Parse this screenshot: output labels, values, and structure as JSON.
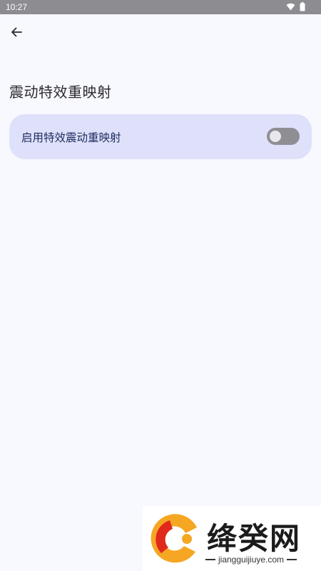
{
  "status_bar": {
    "time": "10:27",
    "icons": [
      "wifi-icon",
      "battery-icon"
    ]
  },
  "header": {
    "back_icon": "arrow-left-icon"
  },
  "page": {
    "title": "震动特效重映射"
  },
  "setting": {
    "label": "启用特效震动重映射",
    "toggle_on": false
  },
  "watermark": {
    "brand": "绛癸网",
    "domain": "jiangguijiuye.com"
  },
  "colors": {
    "background": "#f8f8ff",
    "card": "#dfe1fb",
    "toggle_track_off": "#8e8e94",
    "status_bar": "#8d8d91",
    "logo_orange": "#f5a623",
    "logo_red": "#e0281c"
  }
}
